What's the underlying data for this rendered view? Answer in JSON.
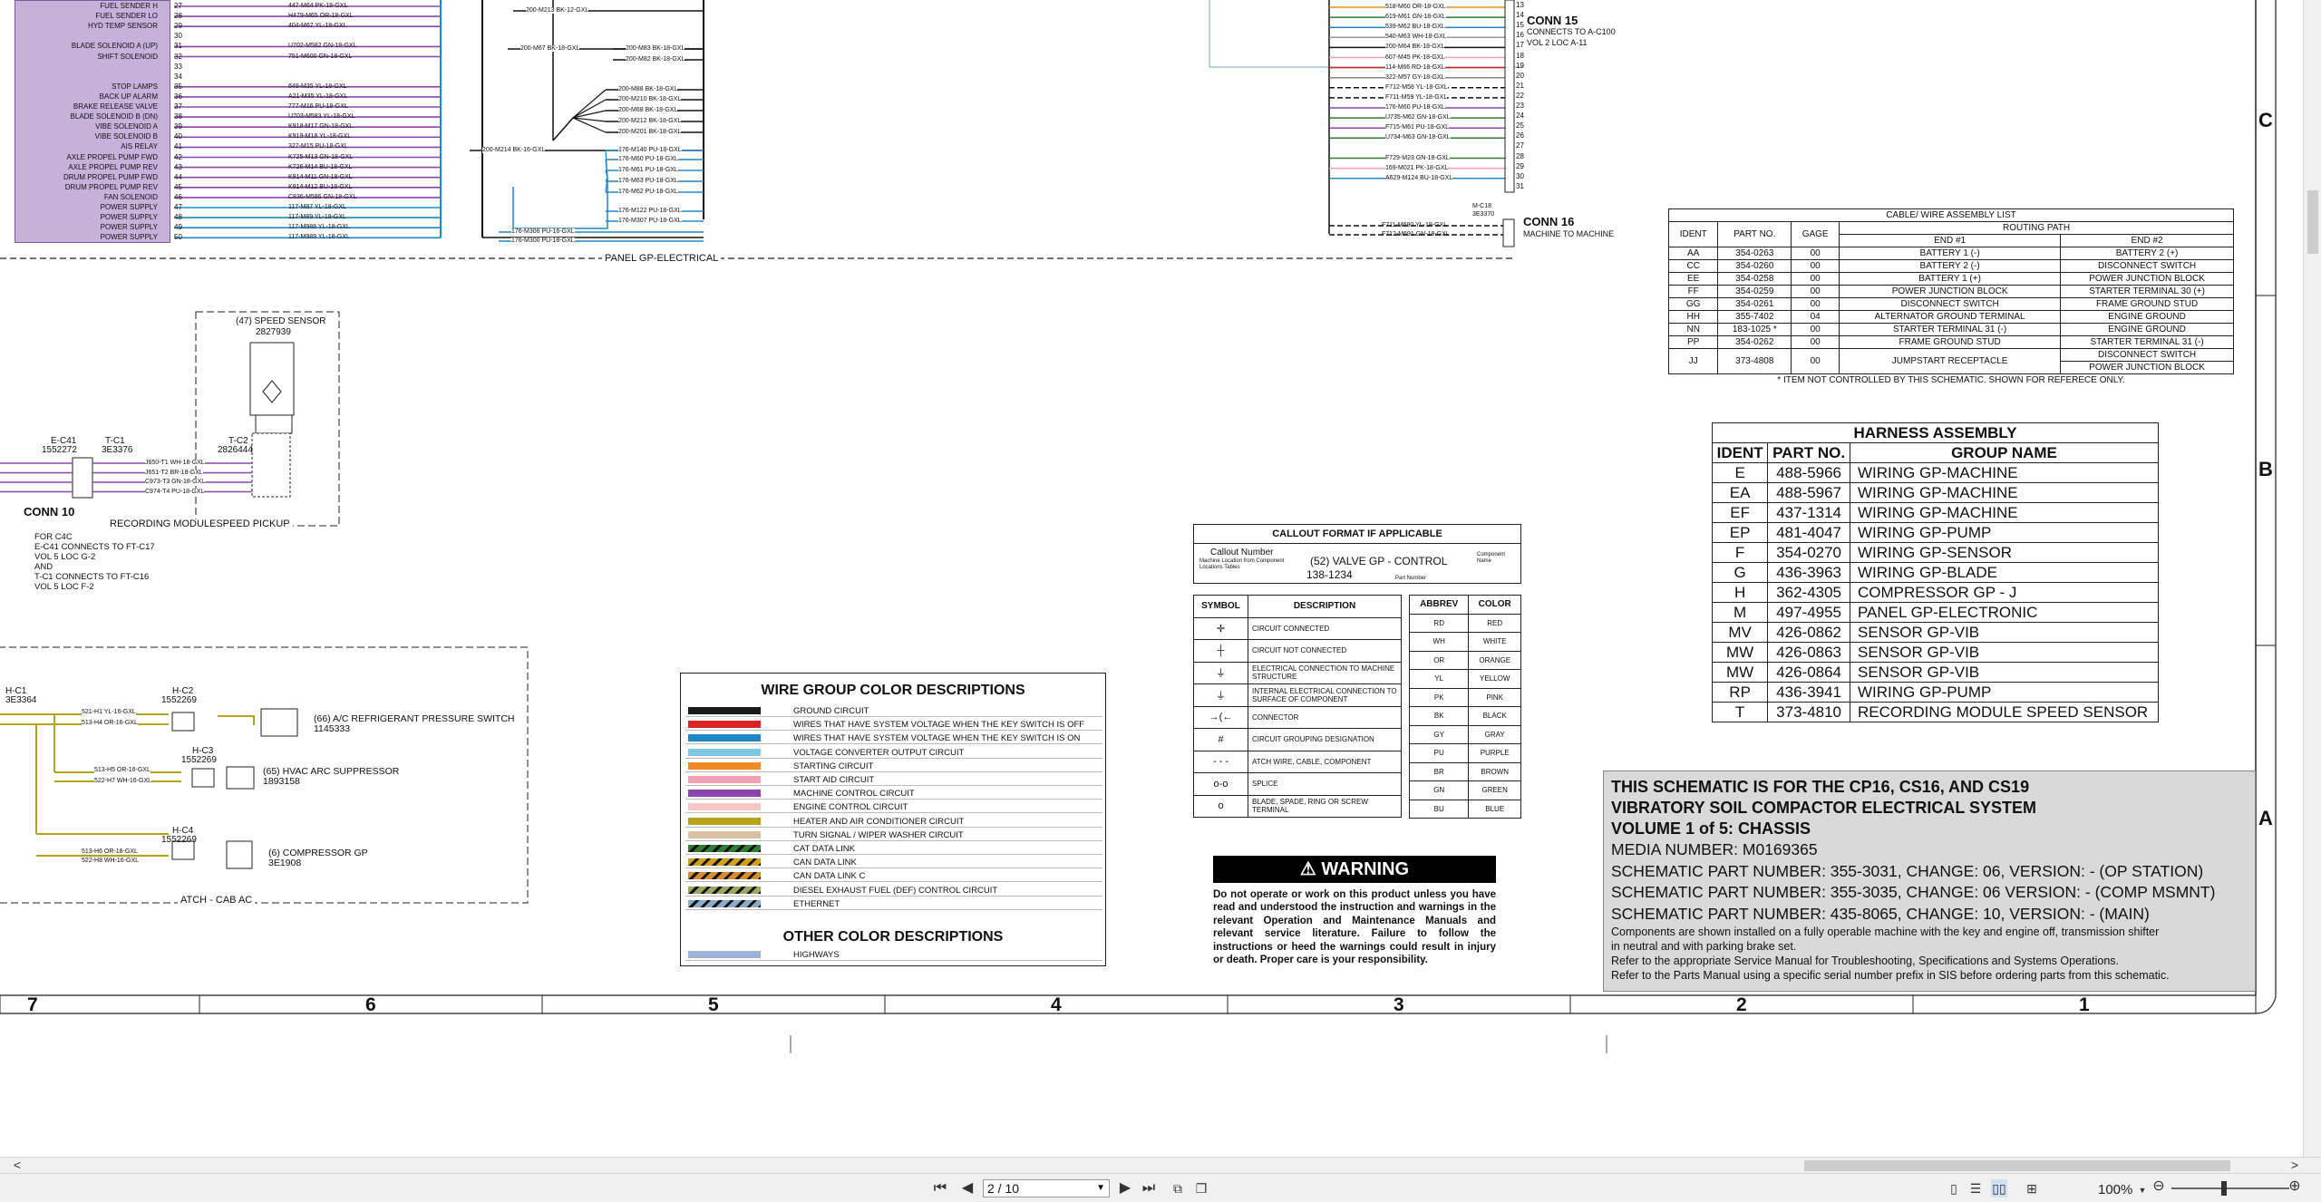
{
  "schematic": {
    "left_labels": [
      "FUEL SENDER H",
      "FUEL SENDER LO",
      "HYD TEMP SENSOR",
      "",
      "BLADE SOLENOID A (UP)",
      "SHIFT SOLENOID",
      "",
      "",
      "STOP LAMPS",
      "BACK UP ALARM",
      "BRAKE RELEASE VALVE",
      "BLADE SOLENOID B (DN)",
      "VIBE SOLENOID A",
      "VIBE SOLENOID B",
      "AIS RELAY",
      "AXLE PROPEL PUMP FWD",
      "AXLE PROPEL PUMP REV",
      "DRUM PROPEL PUMP FWD",
      "DRUM PROPEL PUMP REV",
      "FAN SOLENOID",
      "POWER SUPPLY",
      "POWER SUPPLY",
      "POWER SUPPLY",
      "POWER SUPPLY"
    ],
    "left_pins": [
      "27",
      "28",
      "29",
      "30",
      "31",
      "32",
      "33",
      "34",
      "35",
      "36",
      "37",
      "38",
      "39",
      "40",
      "41",
      "42",
      "43",
      "44",
      "45",
      "46",
      "47",
      "48",
      "49",
      "50"
    ],
    "left_wires": [
      "447-M64  PK-18-GXL",
      "H479-M65  OR-18-GXL",
      "404-M67  YL-18-GXL",
      "",
      "U702-M582  GN-18-GXL",
      "751-M600  GN-18-GXL",
      "",
      "",
      "649-M35  YL-18-GXL",
      "A21-M35  YL-18-GXL",
      "777-M16  PU-18-GXL",
      "U703-M583  YL-18-GXL",
      "K918-M17  GN-18-GXL",
      "K919-M18  YL-18-GXL",
      "327-M15  PU-18-GXL",
      "K725-M13  GN-18-GXL",
      "K726-M14  BU-18-GXL",
      "K914-M11  GN-18-GXL",
      "K914-M12  BU-18-GXL",
      "C836-M586  GN-18-GXL",
      "117-M87  YL-18-GXL",
      "117-M89  YL-18-GXL",
      "117-M988  YL-18-GXL",
      "117-M989  YL-18-GXL"
    ],
    "mid_wires": [
      "200-M213  BK-12-GXL",
      "200-M67  BK-18-GXL",
      "200-M83  BK-18-GXL",
      "200-M82  BK-18-GXL",
      "200-M88  BK-18-GXL",
      "200-M210  BK-18-GXL",
      "200-M68  BK-18-GXL",
      "200-M212  BK-18-GXL",
      "200-M201  BK-18-GXL",
      "200-M214  BK-16-GXL",
      "176-M140  PU-18-GXL",
      "176-M60  PU-18-GXL",
      "176-M61  PU-18-GXL",
      "176-M63  PU-18-GXL",
      "176-M62  PU-18-GXL",
      "176-M122  PU-18-GXL",
      "176-M307  PU-18-GXL",
      "176-M306  PU-16-GXL",
      "176-M300  PU-18-GXL"
    ],
    "right_wires": [
      "518-M60  OR-18-GXL",
      "619-M61  GN-18-GXL",
      "539-M62  BU-18-GXL",
      "540-M63  WH-18-GXL",
      "200-M64  BK-18-GXL",
      "607-M45  PK-18-GXL",
      "114-M66  RD-18-GXL",
      "322-M57  GY-18-GXL",
      "F712-M58  YL-18-GXL",
      "F711-M59  YL-18-GXL",
      "176-M60  PU-18-GXL",
      "U735-M62  GN-18-GXL",
      "F715-M61  PU-18-GXL",
      "U734-M63  GN-18-GXL",
      "",
      "F729-M23  GN-18-GXL",
      "169-M021  PK-18-GXL",
      "A629-M124  BU-18-GXL"
    ],
    "right_pins": [
      "13",
      "14",
      "15",
      "16",
      "17",
      "18",
      "19",
      "20",
      "21",
      "22",
      "23",
      "24",
      "25",
      "26",
      "27",
      "28",
      "29",
      "30",
      "31"
    ],
    "conn15_title": "CONN 15",
    "conn15_sub1": "CONNECTS TO A-C100",
    "conn15_sub2": "VOL 2 LOC A-11",
    "conn16_title": "CONN 16",
    "conn16_sub": "MACHINE TO MACHINE",
    "mc18_label": "M-C18",
    "mc18_part": "3E3370",
    "conn16_wires": [
      "F711-M690  YL-18-GXL",
      "F712-M691  GN-18-GXL"
    ],
    "panel_label": "PANEL GP-ELECTRICAL",
    "speed_sensor_title": "(47) SPEED SENSOR",
    "speed_sensor_part": "2827939",
    "tc2_label": "T-C2",
    "tc2_part": "2826444",
    "ec41_label": "E-C41",
    "ec41_part": "1552272",
    "tc1_label": "T-C1",
    "tc1_part": "3E3376",
    "conn10_wires": [
      "J650-T1  WH-18-GXL",
      "J651-T2  BR-18-GXL",
      "C973-T3  GN-18-GXL",
      "C974-T4  PU-18-GXL"
    ],
    "conn10_title": "CONN 10",
    "recording_label": "RECORDING MODULESPEED PICKUP",
    "conn10_notes": [
      "FOR C4C",
      "E-C41 CONNECTS TO FT-C17",
      "VOL 5 LOC G-2",
      "AND",
      "T-C1 CONNECTS TO FT-C16",
      "VOL 5 LOC F-2"
    ],
    "hc1_label": "H-C1",
    "hc1_part": "3E3364",
    "hc2_label": "H-C2",
    "hc2_part": "1552269",
    "hc3_label": "H-C3",
    "hc3_part": "1552269",
    "hc4_label": "H-C4",
    "hc4_part": "1552269",
    "hvac_wires": [
      "521-H1  YL-16-GXL",
      "513-H4  OR-16-GXL",
      "513-H5  OR-16-GXL",
      "522-H7  WH-16-GXL",
      "513-H6  OR-16-GXL",
      "522-H8  WH-16-GXL"
    ],
    "hvac_items": [
      "(66) A/C REFRIGERANT PRESSURE SWITCH",
      "1145333",
      "(65) HVAC ARC SUPPRESSOR",
      "1893158",
      "(6) COMPRESSOR GP",
      "3E1908"
    ],
    "atch_label": "ATCH - CAB AC"
  },
  "cable_list": {
    "title": "CABLE/ WIRE ASSEMBLY LIST",
    "routing": "ROUTING PATH",
    "headers": [
      "IDENT",
      "PART NO.",
      "GAGE",
      "END #1",
      "END #2"
    ],
    "rows": [
      [
        "AA",
        "354-0263",
        "00",
        "BATTERY 1 (-)",
        "BATTERY 2 (+)"
      ],
      [
        "CC",
        "354-0260",
        "00",
        "BATTERY 2 (-)",
        "DISCONNECT SWITCH"
      ],
      [
        "EE",
        "354-0258",
        "00",
        "BATTERY 1 (+)",
        "POWER JUNCTION BLOCK"
      ],
      [
        "FF",
        "354-0259",
        "00",
        "POWER JUNCTION BLOCK",
        "STARTER TERMINAL 30 (+)"
      ],
      [
        "GG",
        "354-0261",
        "00",
        "DISCONNECT SWITCH",
        "FRAME GROUND STUD"
      ],
      [
        "HH",
        "355-7402",
        "04",
        "ALTERNATOR GROUND TERMINAL",
        "ENGINE GROUND"
      ],
      [
        "NN",
        "183-1025 *",
        "00",
        "STARTER TERMINAL 31 (-)",
        "ENGINE GROUND"
      ],
      [
        "PP",
        "354-0262",
        "00",
        "FRAME GROUND STUD",
        "STARTER TERMINAL 31 (-)"
      ]
    ],
    "jj": {
      "ident": "JJ",
      "part": "373-4808",
      "gage": "00",
      "end1": "JUMPSTART RECEPTACLE",
      "end2a": "DISCONNECT SWITCH",
      "end2b": "POWER JUNCTION BLOCK"
    },
    "footnote": "*  ITEM NOT CONTROLLED BY THIS SCHEMATIC.  SHOWN FOR REFERECE ONLY."
  },
  "harness": {
    "title": "HARNESS ASSEMBLY",
    "headers": [
      "IDENT",
      "PART NO.",
      "GROUP NAME"
    ],
    "rows": [
      [
        "E",
        "488-5966",
        "WIRING GP-MACHINE"
      ],
      [
        "EA",
        "488-5967",
        "WIRING GP-MACHINE"
      ],
      [
        "EF",
        "437-1314",
        "WIRING GP-MACHINE"
      ],
      [
        "EP",
        "481-4047",
        "WIRING GP-PUMP"
      ],
      [
        "F",
        "354-0270",
        "WIRING GP-SENSOR"
      ],
      [
        "G",
        "436-3963",
        "WIRING GP-BLADE"
      ],
      [
        "H",
        "362-4305",
        "COMPRESSOR GP - J"
      ],
      [
        "M",
        "497-4955",
        "PANEL GP-ELECTRONIC"
      ],
      [
        "MV",
        "426-0862",
        "SENSOR GP-VIB"
      ],
      [
        "MW",
        "426-0863",
        "SENSOR GP-VIB"
      ],
      [
        "MW",
        "426-0864",
        "SENSOR GP-VIB"
      ],
      [
        "RP",
        "436-3941",
        "WIRING GP-PUMP"
      ],
      [
        "T",
        "373-4810",
        "RECORDING MODULE SPEED SENSOR"
      ]
    ]
  },
  "callout": {
    "title": "CALLOUT FORMAT IF APPLICABLE",
    "callout_number": "Callout Number",
    "machine_loc": "Machine Location from Component Locations Tables",
    "example": "(52) VALVE GP - CONTROL",
    "example_part": "138-1234",
    "component_name": "Component Name",
    "part_number": "Part Number"
  },
  "symbols": {
    "headers": [
      "SYMBOL",
      "DESCRIPTION"
    ],
    "rows": [
      [
        "✛",
        "CIRCUIT CONNECTED"
      ],
      [
        "┼",
        "CIRCUIT NOT CONNECTED"
      ],
      [
        "⏚",
        "ELECTRICAL CONNECTION TO MACHINE STRUCTURE"
      ],
      [
        "⏚",
        "INTERNAL ELECTRICAL CONNECTION TO SURFACE OF COMPONENT"
      ],
      [
        "→(←",
        "CONNECTOR"
      ],
      [
        "#",
        "CIRCUIT GROUPING DESIGNATION"
      ],
      [
        "- - -",
        "ATCH WIRE, CABLE, COMPONENT"
      ],
      [
        "o-o",
        "SPLICE"
      ],
      [
        "o",
        "BLADE, SPADE, RING OR SCREW TERMINAL"
      ]
    ]
  },
  "abbrev": {
    "headers": [
      "ABBREV",
      "COLOR"
    ],
    "rows": [
      [
        "RD",
        "RED"
      ],
      [
        "WH",
        "WHITE"
      ],
      [
        "OR",
        "ORANGE"
      ],
      [
        "YL",
        "YELLOW"
      ],
      [
        "PK",
        "PINK"
      ],
      [
        "BK",
        "BLACK"
      ],
      [
        "GY",
        "GRAY"
      ],
      [
        "PU",
        "PURPLE"
      ],
      [
        "BR",
        "BROWN"
      ],
      [
        "GN",
        "GREEN"
      ],
      [
        "BU",
        "BLUE"
      ]
    ]
  },
  "wire_colors": {
    "title": "WIRE GROUP COLOR DESCRIPTIONS",
    "rows": [
      {
        "label": "GROUND CIRCUIT",
        "color": "#1a1a1a",
        "style": "solid"
      },
      {
        "label": "WIRES THAT HAVE SYSTEM VOLTAGE WHEN THE KEY SWITCH IS OFF",
        "color": "#d92424",
        "style": "solid"
      },
      {
        "label": "WIRES THAT HAVE SYSTEM VOLTAGE WHEN THE KEY SWITCH IS ON",
        "color": "#1e88c8",
        "style": "solid"
      },
      {
        "label": "VOLTAGE CONVERTER OUTPUT CIRCUIT",
        "color": "#7ec8e3",
        "style": "solid"
      },
      {
        "label": "STARTING CIRCUIT",
        "color": "#f08a24",
        "style": "solid"
      },
      {
        "label": "START AID CIRCUIT",
        "color": "#f4a0b4",
        "style": "solid"
      },
      {
        "label": "MACHINE CONTROL CIRCUIT",
        "color": "#8e44ad",
        "style": "solid"
      },
      {
        "label": "ENGINE CONTROL CIRCUIT",
        "color": "#f6c6c6",
        "style": "solid"
      },
      {
        "label": "HEATER AND AIR CONDITIONER CIRCUIT",
        "color": "#b5a31a",
        "style": "solid"
      },
      {
        "label": "TURN SIGNAL / WIPER WASHER CIRCUIT",
        "color": "#d8c0a0",
        "style": "solid"
      },
      {
        "label": "CAT DATA LINK",
        "color": "#2e7d32",
        "style": "hatch"
      },
      {
        "label": "CAN DATA LINK",
        "color": "#d4a017",
        "style": "hatch"
      },
      {
        "label": "CAN DATA LINK C",
        "color": "#d98c2b",
        "style": "hatch"
      },
      {
        "label": "DIESEL EXHAUST FUEL (DEF) CONTROL CIRCUIT",
        "color": "#9aa860",
        "style": "hatch"
      },
      {
        "label": "ETHERNET",
        "color": "#88aacc",
        "style": "hatch"
      }
    ],
    "other_title": "OTHER COLOR DESCRIPTIONS",
    "other_rows": [
      {
        "label": "HIGHWAYS",
        "color": "#9bb3d6",
        "style": "solid"
      }
    ]
  },
  "warning": {
    "title": "WARNING",
    "body": "Do not operate or work on this product unless you have read and understood the instruction and warnings in the relevant Operation and Maintenance Manuals and relevant service literature. Failure to follow the instructions or heed the warnings could result in injury or death. Proper care is your responsibility."
  },
  "title_block": {
    "line1": "THIS SCHEMATIC IS FOR THE  CP16, CS16, AND CS19",
    "line2": "VIBRATORY SOIL COMPACTOR ELECTRICAL SYSTEM",
    "line3": "VOLUME 1 of 5: CHASSIS",
    "media": "MEDIA NUMBER: M0169365",
    "part1": "SCHEMATIC PART NUMBER: 355-3031, CHANGE: 06, VERSION: - (OP STATION)",
    "part2": "SCHEMATIC PART NUMBER: 355-3035, CHANGE: 06 VERSION: - (COMP MSMNT)",
    "part3": "SCHEMATIC PART NUMBER: 435-8065, CHANGE: 10, VERSION: - (MAIN)",
    "note1": "Components are shown installed on a fully operable machine with the key and engine off, transmission shifter",
    "note2": "in neutral and with parking brake set.",
    "note3": "Refer to the appropriate Service Manual for Troubleshooting, Specifications and Systems Operations.",
    "note4": "Refer to the Parts Manual using a specific serial number prefix in SIS before ordering parts from this schematic."
  },
  "zones": {
    "rows": [
      "C",
      "B",
      "A"
    ],
    "cols": [
      "7",
      "6",
      "5",
      "4",
      "3",
      "2",
      "1"
    ]
  },
  "viewer": {
    "page_value": "2 / 10",
    "zoom": "100%",
    "first_icon": "⏮",
    "prev_icon": "◀",
    "next_icon": "▶",
    "last_icon": "⏭",
    "left_arrow": "<",
    "right_arrow": ">"
  }
}
